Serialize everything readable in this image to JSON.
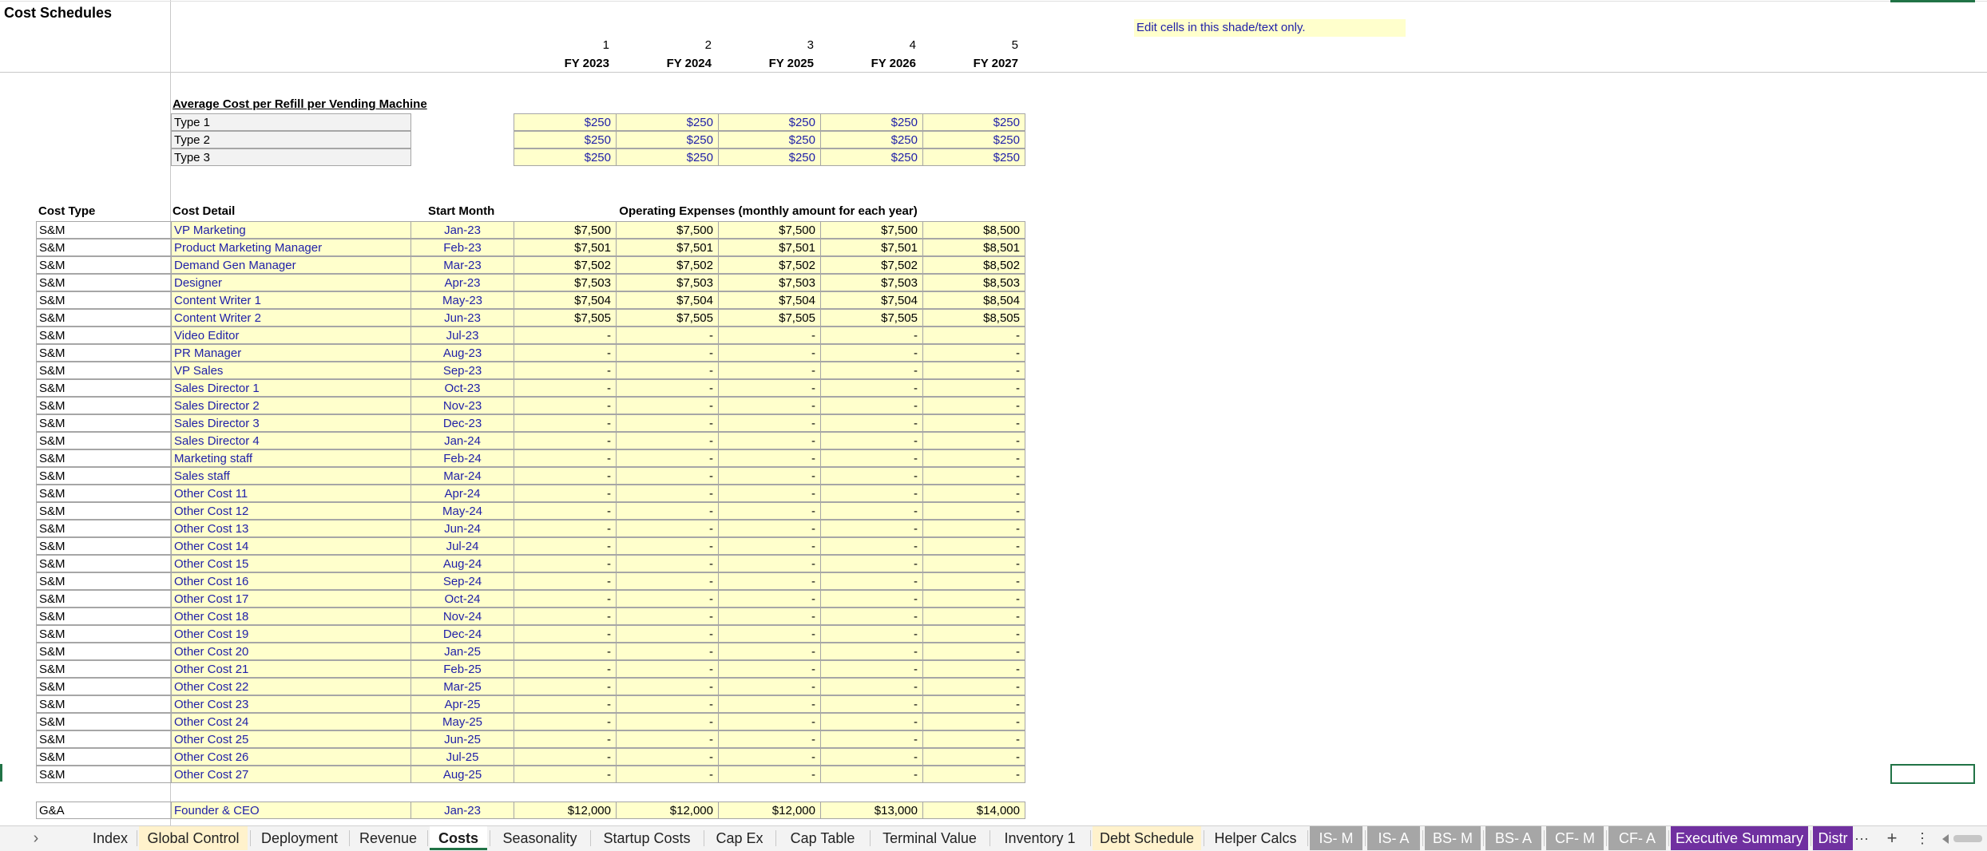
{
  "sheet": {
    "title": "Cost Schedules",
    "note": "Edit cells in this shade/text only."
  },
  "years": {
    "numbers": [
      "1",
      "2",
      "3",
      "4",
      "5"
    ],
    "labels": [
      "FY 2023",
      "FY 2024",
      "FY 2025",
      "FY 2026",
      "FY 2027"
    ]
  },
  "refill": {
    "heading": "Average Cost per Refill per Vending Machine",
    "rows": [
      {
        "label": "Type 1",
        "values": [
          "$250",
          "$250",
          "$250",
          "$250",
          "$250"
        ]
      },
      {
        "label": "Type 2",
        "values": [
          "$250",
          "$250",
          "$250",
          "$250",
          "$250"
        ]
      },
      {
        "label": "Type 3",
        "values": [
          "$250",
          "$250",
          "$250",
          "$250",
          "$250"
        ]
      }
    ]
  },
  "opex": {
    "headers": {
      "cost_type": "Cost Type",
      "cost_detail": "Cost Detail",
      "start_month": "Start Month",
      "values": "Operating Expenses (monthly amount for each year)"
    },
    "rows": [
      {
        "type": "S&M",
        "detail": "VP Marketing",
        "start": "Jan-23",
        "values": [
          "$7,500",
          "$7,500",
          "$7,500",
          "$7,500",
          "$8,500"
        ]
      },
      {
        "type": "S&M",
        "detail": "Product Marketing Manager",
        "start": "Feb-23",
        "values": [
          "$7,501",
          "$7,501",
          "$7,501",
          "$7,501",
          "$8,501"
        ]
      },
      {
        "type": "S&M",
        "detail": "Demand Gen Manager",
        "start": "Mar-23",
        "values": [
          "$7,502",
          "$7,502",
          "$7,502",
          "$7,502",
          "$8,502"
        ]
      },
      {
        "type": "S&M",
        "detail": "Designer",
        "start": "Apr-23",
        "values": [
          "$7,503",
          "$7,503",
          "$7,503",
          "$7,503",
          "$8,503"
        ]
      },
      {
        "type": "S&M",
        "detail": "Content Writer 1",
        "start": "May-23",
        "values": [
          "$7,504",
          "$7,504",
          "$7,504",
          "$7,504",
          "$8,504"
        ]
      },
      {
        "type": "S&M",
        "detail": "Content Writer 2",
        "start": "Jun-23",
        "values": [
          "$7,505",
          "$7,505",
          "$7,505",
          "$7,505",
          "$8,505"
        ]
      },
      {
        "type": "S&M",
        "detail": "Video Editor",
        "start": "Jul-23",
        "values": [
          "-",
          "-",
          "-",
          "-",
          "-"
        ]
      },
      {
        "type": "S&M",
        "detail": "PR Manager",
        "start": "Aug-23",
        "values": [
          "-",
          "-",
          "-",
          "-",
          "-"
        ]
      },
      {
        "type": "S&M",
        "detail": "VP Sales",
        "start": "Sep-23",
        "values": [
          "-",
          "-",
          "-",
          "-",
          "-"
        ]
      },
      {
        "type": "S&M",
        "detail": "Sales Director 1",
        "start": "Oct-23",
        "values": [
          "-",
          "-",
          "-",
          "-",
          "-"
        ]
      },
      {
        "type": "S&M",
        "detail": "Sales Director 2",
        "start": "Nov-23",
        "values": [
          "-",
          "-",
          "-",
          "-",
          "-"
        ]
      },
      {
        "type": "S&M",
        "detail": "Sales Director 3",
        "start": "Dec-23",
        "values": [
          "-",
          "-",
          "-",
          "-",
          "-"
        ]
      },
      {
        "type": "S&M",
        "detail": "Sales Director 4",
        "start": "Jan-24",
        "values": [
          "-",
          "-",
          "-",
          "-",
          "-"
        ]
      },
      {
        "type": "S&M",
        "detail": "Marketing staff",
        "start": "Feb-24",
        "values": [
          "-",
          "-",
          "-",
          "-",
          "-"
        ]
      },
      {
        "type": "S&M",
        "detail": "Sales staff",
        "start": "Mar-24",
        "values": [
          "-",
          "-",
          "-",
          "-",
          "-"
        ]
      },
      {
        "type": "S&M",
        "detail": "Other Cost 11",
        "start": "Apr-24",
        "values": [
          "-",
          "-",
          "-",
          "-",
          "-"
        ]
      },
      {
        "type": "S&M",
        "detail": "Other Cost 12",
        "start": "May-24",
        "values": [
          "-",
          "-",
          "-",
          "-",
          "-"
        ]
      },
      {
        "type": "S&M",
        "detail": "Other Cost 13",
        "start": "Jun-24",
        "values": [
          "-",
          "-",
          "-",
          "-",
          "-"
        ]
      },
      {
        "type": "S&M",
        "detail": "Other Cost 14",
        "start": "Jul-24",
        "values": [
          "-",
          "-",
          "-",
          "-",
          "-"
        ]
      },
      {
        "type": "S&M",
        "detail": "Other Cost 15",
        "start": "Aug-24",
        "values": [
          "-",
          "-",
          "-",
          "-",
          "-"
        ]
      },
      {
        "type": "S&M",
        "detail": "Other Cost 16",
        "start": "Sep-24",
        "values": [
          "-",
          "-",
          "-",
          "-",
          "-"
        ]
      },
      {
        "type": "S&M",
        "detail": "Other Cost 17",
        "start": "Oct-24",
        "values": [
          "-",
          "-",
          "-",
          "-",
          "-"
        ]
      },
      {
        "type": "S&M",
        "detail": "Other Cost 18",
        "start": "Nov-24",
        "values": [
          "-",
          "-",
          "-",
          "-",
          "-"
        ]
      },
      {
        "type": "S&M",
        "detail": "Other Cost 19",
        "start": "Dec-24",
        "values": [
          "-",
          "-",
          "-",
          "-",
          "-"
        ]
      },
      {
        "type": "S&M",
        "detail": "Other Cost 20",
        "start": "Jan-25",
        "values": [
          "-",
          "-",
          "-",
          "-",
          "-"
        ]
      },
      {
        "type": "S&M",
        "detail": "Other Cost 21",
        "start": "Feb-25",
        "values": [
          "-",
          "-",
          "-",
          "-",
          "-"
        ]
      },
      {
        "type": "S&M",
        "detail": "Other Cost 22",
        "start": "Mar-25",
        "values": [
          "-",
          "-",
          "-",
          "-",
          "-"
        ]
      },
      {
        "type": "S&M",
        "detail": "Other Cost 23",
        "start": "Apr-25",
        "values": [
          "-",
          "-",
          "-",
          "-",
          "-"
        ]
      },
      {
        "type": "S&M",
        "detail": "Other Cost 24",
        "start": "May-25",
        "values": [
          "-",
          "-",
          "-",
          "-",
          "-"
        ]
      },
      {
        "type": "S&M",
        "detail": "Other Cost 25",
        "start": "Jun-25",
        "values": [
          "-",
          "-",
          "-",
          "-",
          "-"
        ]
      },
      {
        "type": "S&M",
        "detail": "Other Cost 26",
        "start": "Jul-25",
        "values": [
          "-",
          "-",
          "-",
          "-",
          "-"
        ]
      },
      {
        "type": "S&M",
        "detail": "Other Cost 27",
        "start": "Aug-25",
        "values": [
          "-",
          "-",
          "-",
          "-",
          "-"
        ]
      }
    ],
    "ga_row": {
      "type": "G&A",
      "detail": "Founder & CEO",
      "start": "Jan-23",
      "values": [
        "$12,000",
        "$12,000",
        "$12,000",
        "$13,000",
        "$14,000"
      ]
    }
  },
  "tabs": [
    {
      "label": "Index",
      "style": "normal"
    },
    {
      "label": "Global Control",
      "style": "yellowtab"
    },
    {
      "label": "Deployment",
      "style": "normal"
    },
    {
      "label": "Revenue",
      "style": "normal"
    },
    {
      "label": "Costs",
      "style": "active"
    },
    {
      "label": "Seasonality",
      "style": "normal"
    },
    {
      "label": "Startup Costs",
      "style": "normal"
    },
    {
      "label": "Cap Ex",
      "style": "normal"
    },
    {
      "label": "Cap Table",
      "style": "normal"
    },
    {
      "label": "Terminal Value",
      "style": "normal"
    },
    {
      "label": "Inventory 1",
      "style": "normal"
    },
    {
      "label": "Debt Schedule",
      "style": "yellowtab"
    },
    {
      "label": "Helper Calcs",
      "style": "normal"
    },
    {
      "label": "IS- M",
      "style": "greytab"
    },
    {
      "label": "IS- A",
      "style": "greytab"
    },
    {
      "label": "BS- M",
      "style": "greytab"
    },
    {
      "label": "BS- A",
      "style": "greytab"
    },
    {
      "label": "CF- M",
      "style": "greytab"
    },
    {
      "label": "CF- A",
      "style": "greytab"
    },
    {
      "label": "Executive Summary",
      "style": "purple"
    },
    {
      "label": "Distr",
      "style": "purple"
    }
  ],
  "tab_controls": {
    "nav_next": "›",
    "more": "···",
    "add": "+",
    "menu": "⋮"
  },
  "colors": {
    "input_fill": "#ffffcc",
    "input_text": "#1f1fa8",
    "active_tab_accent": "#217346",
    "summary_tab": "#7030a0",
    "statement_tab": "#a6a6a6"
  }
}
